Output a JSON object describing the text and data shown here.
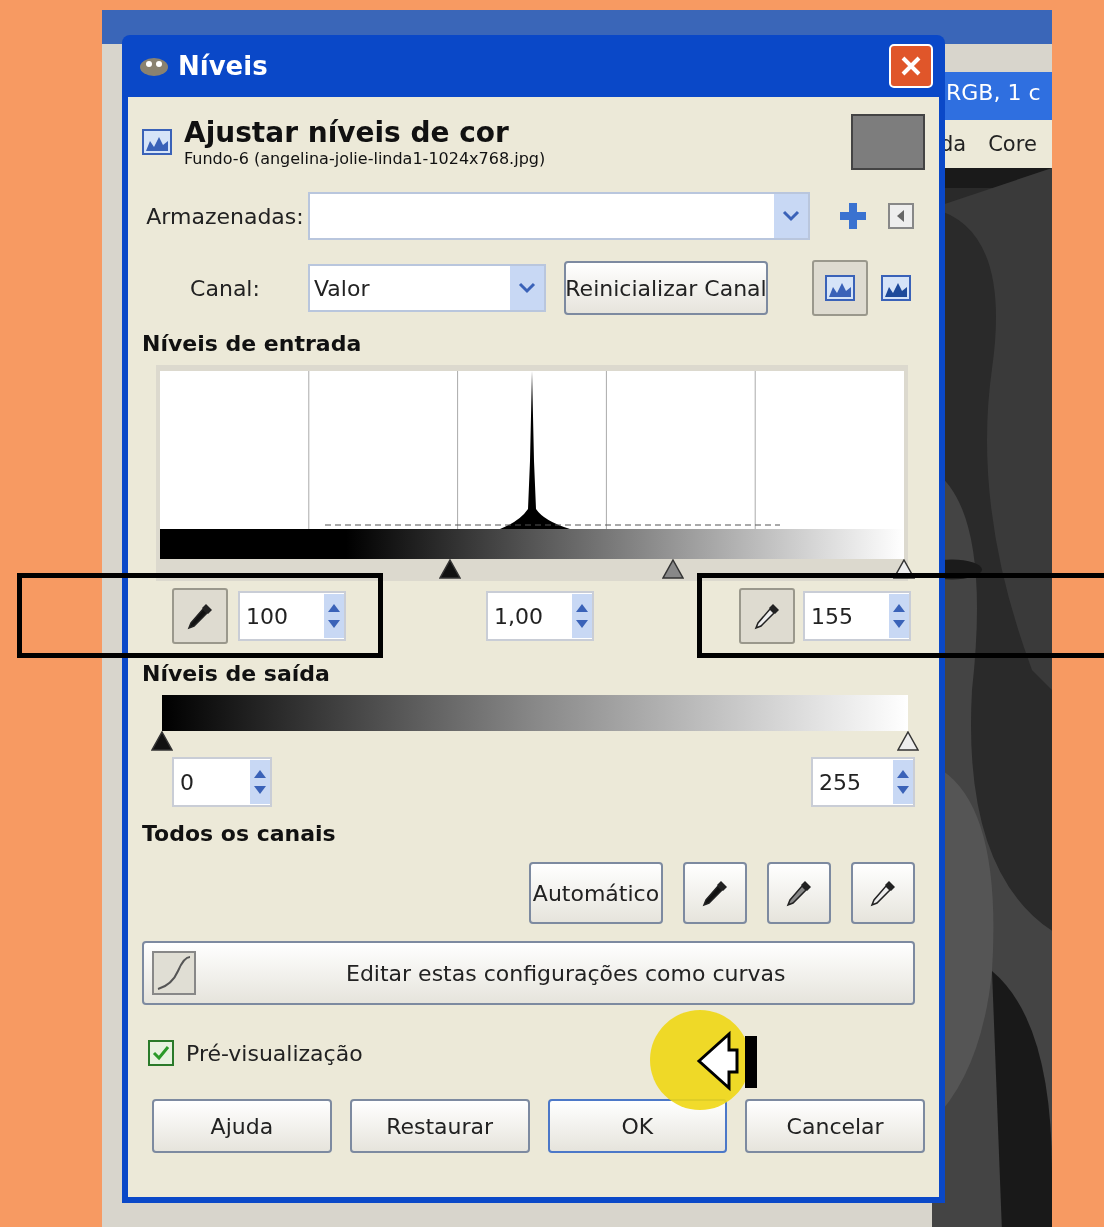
{
  "background_window": {
    "title": "RGB, 1 c",
    "menu": [
      "da",
      "Core"
    ]
  },
  "dialog": {
    "title": "Níveis",
    "heading": "Ajustar níveis de cor",
    "subtitle": "Fundo-6 (angelina-jolie-linda1-1024x768.jpg)",
    "presets": {
      "label": "Armazenadas:"
    },
    "channel": {
      "label": "Canal:",
      "value": "Valor",
      "reset_button": "Reinicializar Canal",
      "scale_modes": [
        {
          "selected": true
        },
        {
          "selected": false
        }
      ]
    },
    "input_levels": {
      "heading": "Níveis de entrada",
      "handles": [
        {
          "level": 0.39
        },
        {
          "level": 0.69
        },
        {
          "level": 1
        }
      ],
      "fields": [
        "100",
        "1,00",
        "155"
      ]
    },
    "output_levels": {
      "heading": "Níveis de saída",
      "handles": [
        {
          "level": 0
        },
        {
          "level": 1
        }
      ],
      "fields": [
        "0",
        "255"
      ]
    },
    "all_channels": {
      "heading": "Todos os canais",
      "auto_button": "Automático"
    },
    "curves_button": "Editar estas configurações como curvas",
    "preview": {
      "label": "Pré-visualização",
      "checked": true
    },
    "buttons": [
      {
        "label": "Ajuda",
        "default": false
      },
      {
        "label": "Restaurar",
        "default": false
      },
      {
        "label": "OK",
        "default": true
      },
      {
        "label": "Cancelar",
        "default": false
      }
    ]
  }
}
